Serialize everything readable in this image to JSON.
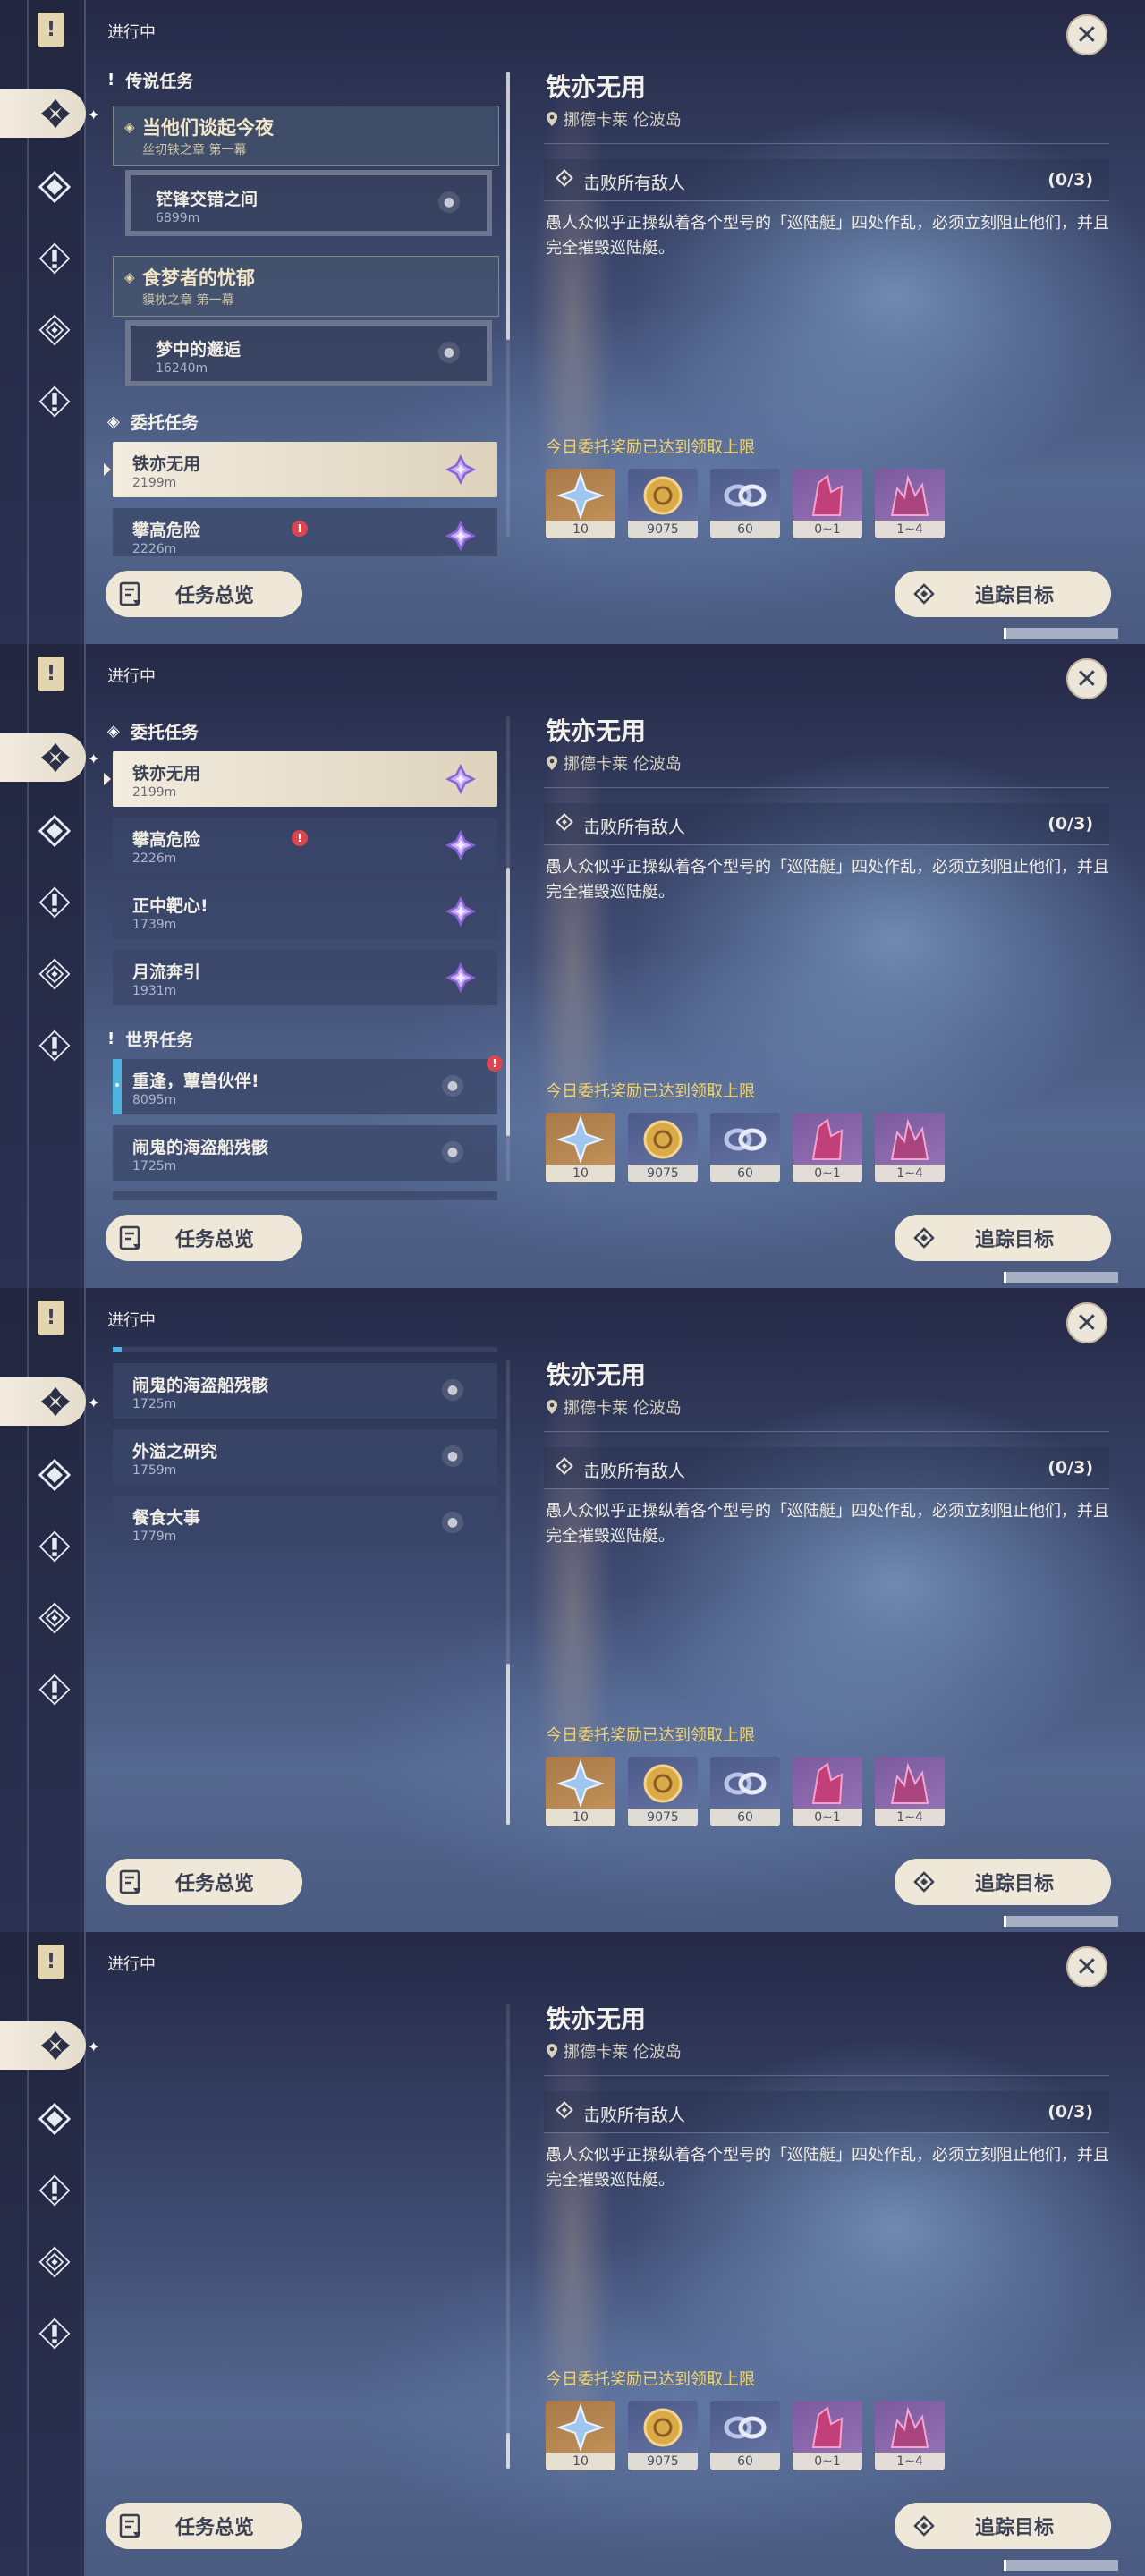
{
  "header": {
    "status": "进行中"
  },
  "sections": {
    "legend": "传说任务",
    "commission": "委托任务",
    "world": "世界任务"
  },
  "legend_quests": [
    {
      "title": "当他们谈起今夜",
      "subtitle": "丝切铁之章 第一幕",
      "sub": {
        "title": "铓锋交错之间",
        "distance": "6899m"
      }
    },
    {
      "title": "食梦者的忧郁",
      "subtitle": "貘枕之章 第一幕",
      "sub": {
        "title": "梦中的邂逅",
        "distance": "16240m"
      }
    }
  ],
  "commissions": [
    {
      "title": "铁亦无用",
      "distance": "2199m"
    },
    {
      "title": "攀高危险",
      "distance": "2226m"
    },
    {
      "title": "正中靶心!",
      "distance": "1739m"
    },
    {
      "title": "月流奔引",
      "distance": "1931m"
    }
  ],
  "world_quests": [
    {
      "title": "重逢，蕈兽伙伴!",
      "distance": "8095m"
    },
    {
      "title": "闹鬼的海盗船残骸",
      "distance": "1725m"
    },
    {
      "title": "外溢之研究",
      "distance": "1759m"
    },
    {
      "title": "餐食大事",
      "distance": "1779m"
    }
  ],
  "detail": {
    "title": "铁亦无用",
    "location": "挪德卡莱 伦波岛",
    "objective": "击败所有敌人",
    "objective_count": "(0/3)",
    "description": "愚人众似乎正操纵着各个型号的「巡陆艇」四处作乱，必须立刻阻止他们，并且完全摧毁巡陆艇。",
    "reward_notice": "今日委托奖励已达到领取上限",
    "rewards": [
      {
        "icon": "primogem-icon",
        "qty": "10",
        "style": "orange"
      },
      {
        "icon": "mora-icon",
        "qty": "9075",
        "style": "blue"
      },
      {
        "icon": "companionship-exp-icon",
        "qty": "60",
        "style": "blue"
      },
      {
        "icon": "crystal-chunk-icon",
        "qty": "0~1",
        "style": "purple"
      },
      {
        "icon": "crystal-cluster-icon",
        "qty": "1~4",
        "style": "purple"
      }
    ]
  },
  "buttons": {
    "overview": "任务总览",
    "track": "追踪目标"
  },
  "colors": {
    "accent_gold": "#f3d46b",
    "button_bg": "#efe8d8",
    "quest_blue": "#4fb3e0",
    "alert_red": "#d9464f"
  }
}
